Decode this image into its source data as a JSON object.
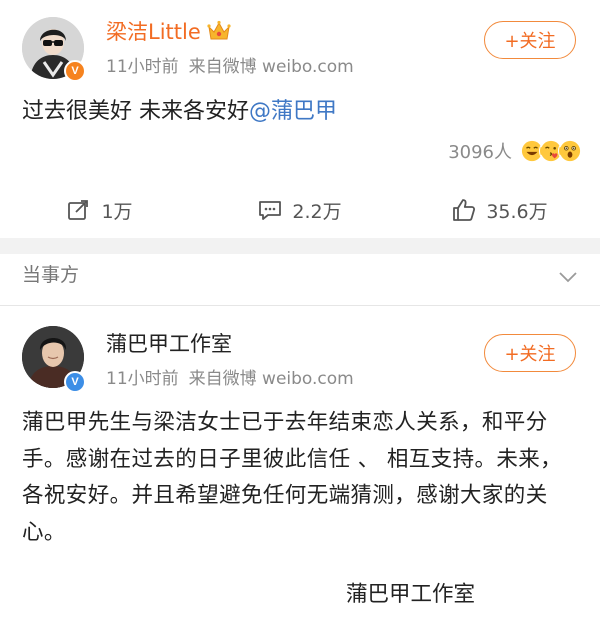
{
  "post": {
    "author": "梁洁Little",
    "time": "11小时前",
    "source": "来自微博 weibo.com",
    "follow_label": "+关注",
    "text": "过去很美好 未来各安好",
    "mention": "@蒲巴甲",
    "reaction_count": "3096人",
    "reposts": "1万",
    "comments": "2.2万",
    "likes": "35.6万",
    "badge": "V",
    "badge_color": "#f6831f"
  },
  "section": {
    "title": "当事方"
  },
  "related_post": {
    "author": "蒲巴甲工作室",
    "time": "11小时前",
    "source": "来自微博 weibo.com",
    "follow_label": "+关注",
    "text": "蒲巴甲先生与梁洁女士已于去年结束恋人关系，和平分手。感谢在过去的日子里彼此信任 、 相互支持。未来，各祝安好。并且希望避免任何无端猜测，感谢大家的关心。",
    "signature": "蒲巴甲工作室",
    "badge": "V",
    "badge_color": "#3c8ee6"
  },
  "colors": {
    "accent_orange": "#f26c23",
    "mention_blue": "#3f78c5",
    "meta_gray": "#8a8a8a"
  }
}
